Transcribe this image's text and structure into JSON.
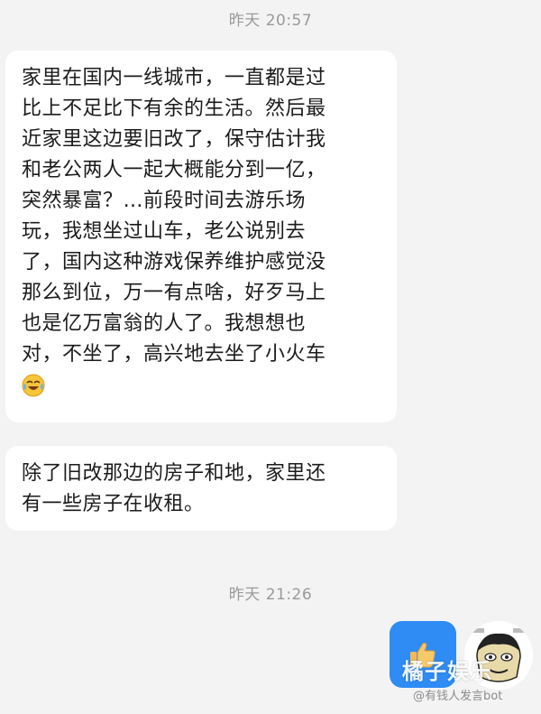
{
  "chat": {
    "timestamp_1": "昨天 20:57",
    "timestamp_2": "昨天 21:26",
    "messages": [
      {
        "direction": "incoming",
        "lines": [
          "家里在国内一线城市，一直都是过",
          "比上不足比下有余的生活。然后最",
          "近家里这边要旧改了，保守估计我",
          "和老公两人一起大概能分到一亿，",
          "突然暴富？…前段时间去游乐场",
          "玩，我想坐过山车，老公说别去",
          "了，国内这种游戏保养维护感觉没",
          "那么到位，万一有点啥，好歹马上",
          "也是亿万富翁的人了。我想想也",
          "对，不坐了，高兴地去坐了小火车"
        ],
        "trailing_icon": "laughing-tears-emoji"
      },
      {
        "direction": "incoming",
        "lines": [
          "除了旧改那边的房子和地，家里还",
          "有一些房子在收租。"
        ]
      },
      {
        "direction": "outgoing",
        "icon": "thumbs-up-icon",
        "bubble_color": "#2e8cf4"
      }
    ],
    "sender_avatar_icon": "meme-face-avatar"
  },
  "watermark": {
    "logo": "橘子娱乐",
    "handle": "@有钱人发言bot"
  },
  "colors": {
    "background": "#f3f3f3",
    "bubble_incoming": "#ffffff",
    "bubble_outgoing": "#2e8cf4",
    "timestamp": "#9a9a9a"
  }
}
